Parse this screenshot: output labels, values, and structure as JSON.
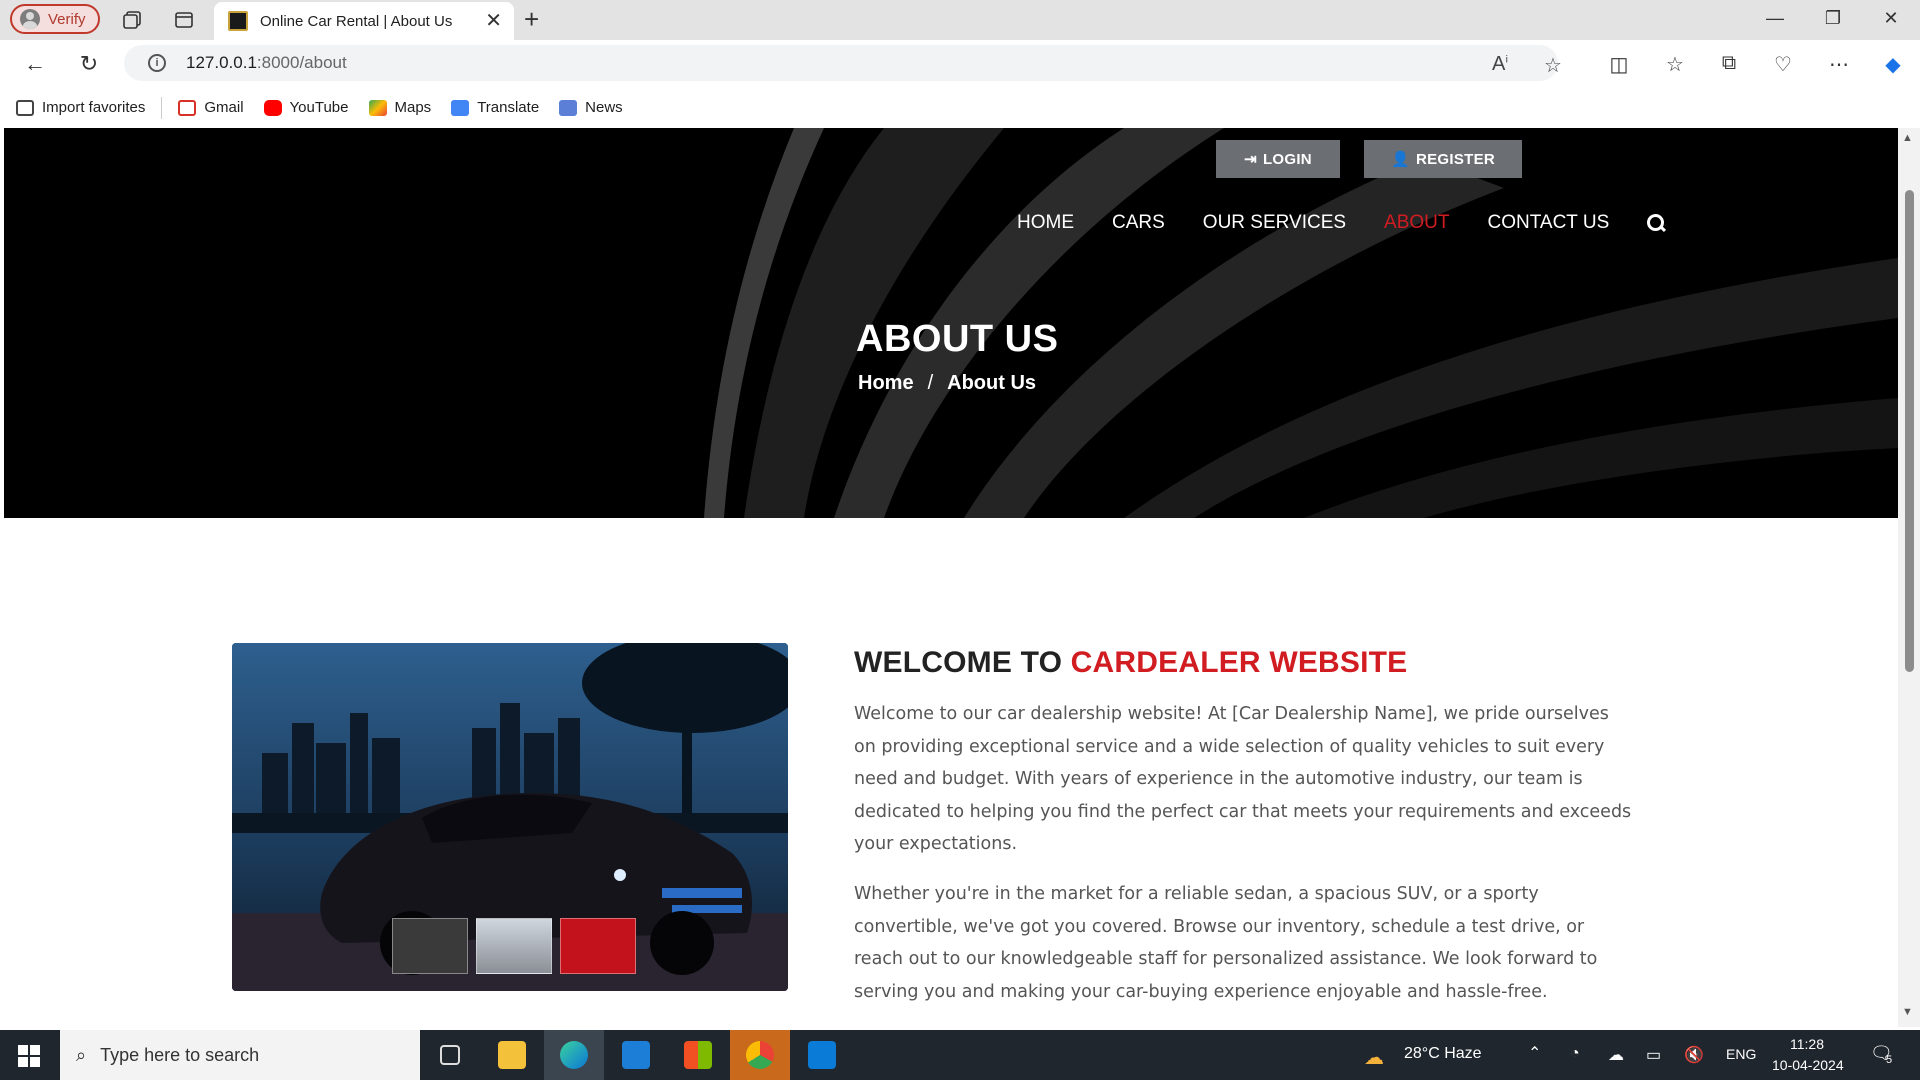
{
  "browser": {
    "profile_label": "Verify",
    "tab_title": "Online Car Rental | About Us",
    "url_host": "127.0.0.1",
    "url_rest": ":8000/about",
    "bookmarks": [
      {
        "label": "Import favorites",
        "icon": "import-icon",
        "color": "#444444"
      },
      {
        "label": "Gmail",
        "icon": "gmail-icon",
        "color": "#d93025"
      },
      {
        "label": "YouTube",
        "icon": "youtube-icon",
        "color": "#ff0000"
      },
      {
        "label": "Maps",
        "icon": "maps-icon",
        "color": "#34a853"
      },
      {
        "label": "Translate",
        "icon": "translate-icon",
        "color": "#4285f4"
      },
      {
        "label": "News",
        "icon": "news-icon",
        "color": "#5b7fd6"
      }
    ]
  },
  "site": {
    "auth": {
      "login": "LOGIN",
      "register": "REGISTER"
    },
    "nav": [
      {
        "label": "HOME",
        "active": false
      },
      {
        "label": "CARS",
        "active": false
      },
      {
        "label": "OUR SERVICES",
        "active": false
      },
      {
        "label": "ABOUT",
        "active": true
      },
      {
        "label": "CONTACT US",
        "active": false
      }
    ],
    "hero_title": "ABOUT US",
    "breadcrumb": {
      "home": "Home",
      "separator": "/",
      "current": "About Us"
    },
    "about": {
      "heading_prefix": "WELCOME TO",
      "heading_accent": "CARDEALER WEBSITE",
      "para1": "Welcome to our car dealership website! At [Car Dealership Name], we pride ourselves on providing exceptional service and a wide selection of quality vehicles to suit every need and budget. With years of experience in the automotive industry, our team is dedicated to helping you find the perfect car that meets your requirements and exceeds your expectations.",
      "para2": "Whether you're in the market for a reliable sedan, a spacious SUV, or a sporty convertible, we've got you covered. Browse our inventory, schedule a test drive, or reach out to our knowledgeable staff for personalized assistance. We look forward to serving you and making your car-buying experience enjoyable and hassle-free."
    },
    "accent_color": "#d11c22"
  },
  "taskbar": {
    "search_placeholder": "Type here to search",
    "weather": "28°C  Haze",
    "language": "ENG",
    "time": "11:28",
    "date": "10-04-2024",
    "notifications": "5"
  }
}
